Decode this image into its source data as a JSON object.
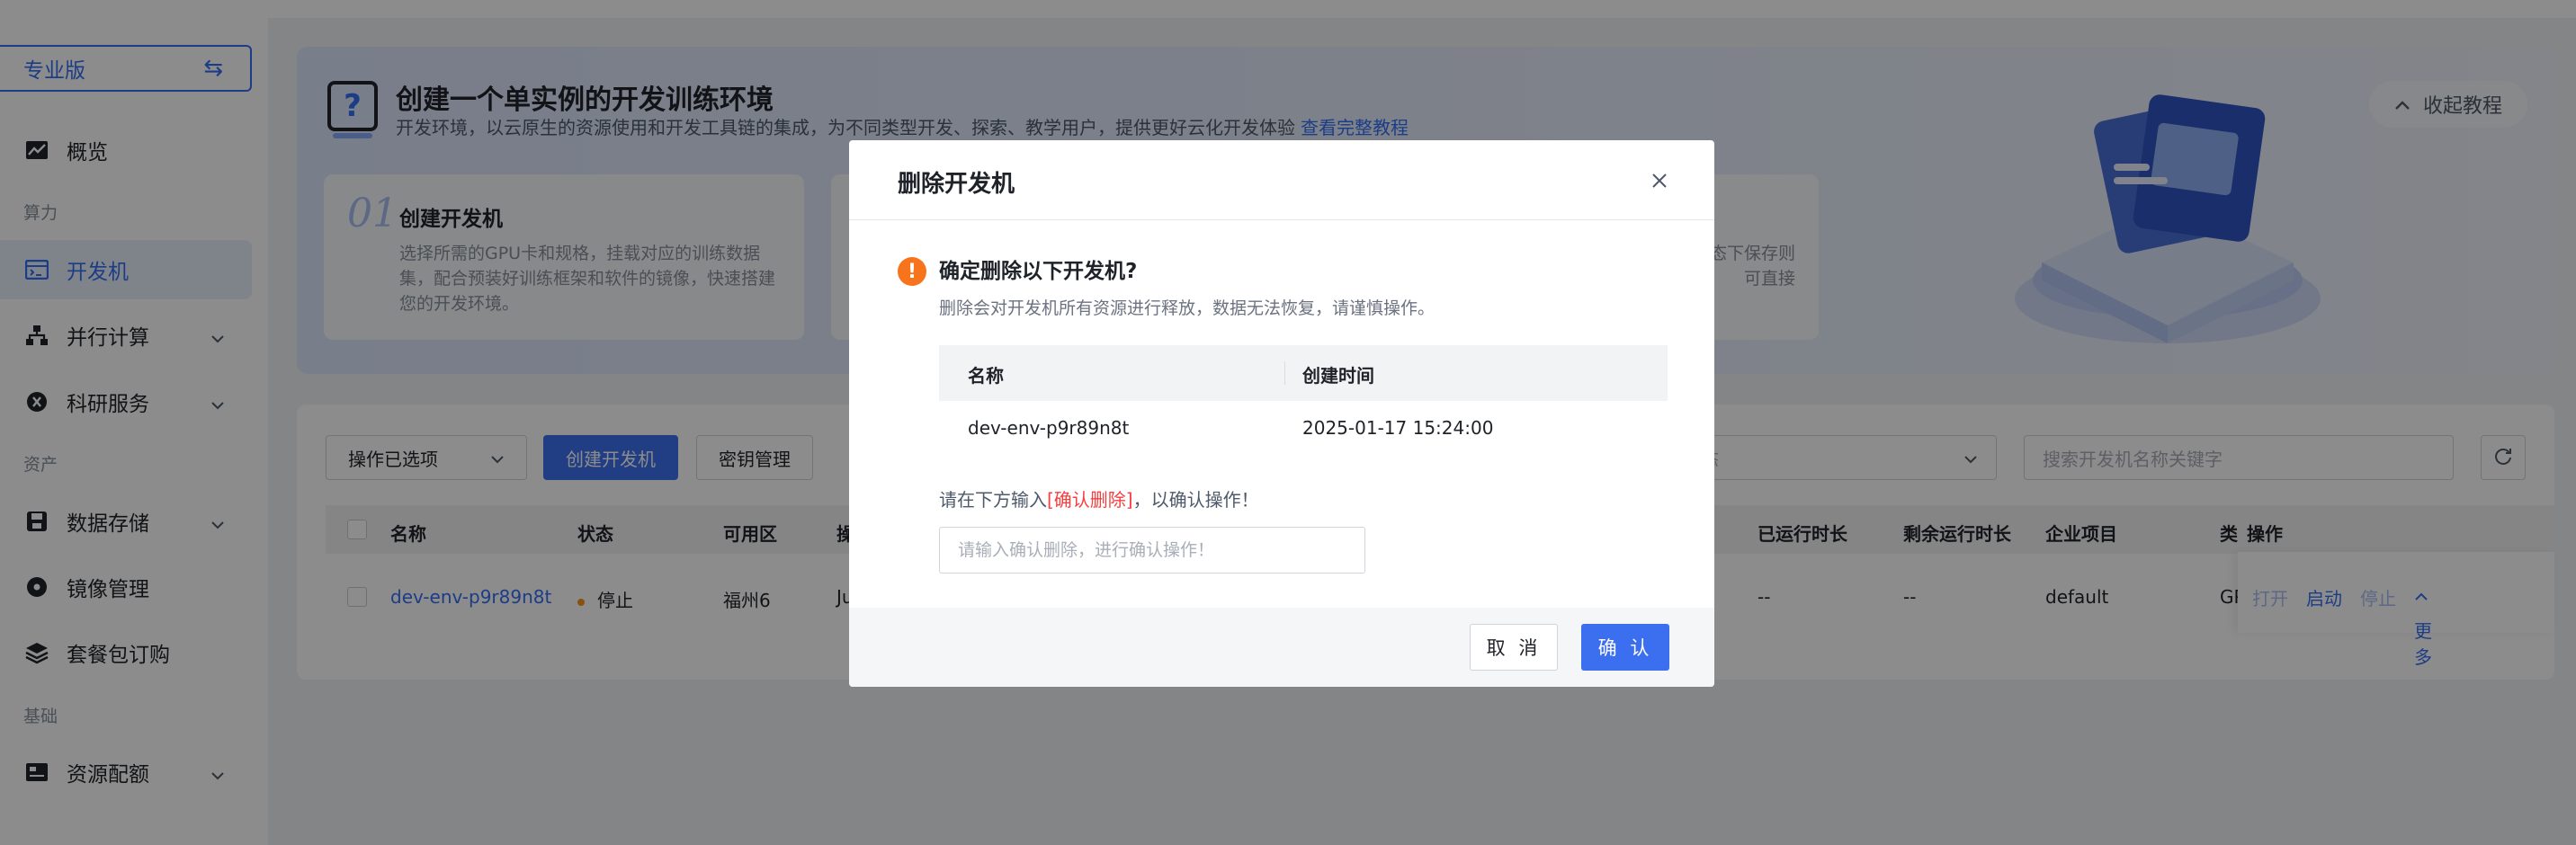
{
  "sidebar": {
    "edition_label": "专业版",
    "items": [
      {
        "label": "概览",
        "icon": "chart-line-icon"
      },
      {
        "label": "开发机",
        "icon": "code-terminal-icon",
        "active": true
      },
      {
        "label": "并行计算",
        "icon": "sitemap-icon"
      },
      {
        "label": "科研服务",
        "icon": "flask-icon"
      },
      {
        "label": "数据存储",
        "icon": "save-disk-icon"
      },
      {
        "label": "镜像管理",
        "icon": "disc-icon"
      },
      {
        "label": "套餐包订购",
        "icon": "layers-icon"
      },
      {
        "label": "资源配额",
        "icon": "quota-icon"
      }
    ],
    "groups": {
      "compute": "算力",
      "assets": "资产",
      "basic": "基础"
    }
  },
  "banner": {
    "title": "创建一个单实例的开发训练环境",
    "desc": "开发环境，以云原生的资源使用和开发工具链的集成，为不同类型开发、探索、教学用户，提供更好云化开发体验",
    "link": "查看完整教程",
    "collapse": "收起教程",
    "step1": {
      "num": "01",
      "title": "创建开发机",
      "desc": "选择所需的GPU卡和规格，挂载对应的训练数据集，配合预装好训练框架和软件的镜像，快速搭建您的开发环境。"
    },
    "step_fragment": "状态下保存则可直接"
  },
  "toolbar": {
    "ops_select": "操作已选项",
    "create": "创建开发机",
    "key_mgmt": "密钥管理",
    "filter_fragment": "态",
    "search_placeholder": "搜索开发机名称关键字"
  },
  "table": {
    "headers": {
      "name": "名称",
      "status": "状态",
      "zone": "可用区",
      "col4": "操",
      "runtime": "已运行时长",
      "remaining": "剩余运行时长",
      "project": "企业项目",
      "type": "类",
      "ops": "操作"
    },
    "row": {
      "name": "dev-env-p9r89n8t",
      "status": "停止",
      "zone": "福州6",
      "col4": "Ju",
      "runtime": "--",
      "remaining": "--",
      "project": "default",
      "type": "GP",
      "ops": {
        "open": "打开",
        "start": "启动",
        "stop": "停止",
        "more": "更多"
      }
    }
  },
  "modal": {
    "title": "删除开发机",
    "question": "确定删除以下开发机?",
    "subtitle": "删除会对开发机所有资源进行释放，数据无法恢复，请谨慎操作。",
    "col_name": "名称",
    "col_time": "创建时间",
    "row_name": "dev-env-p9r89n8t",
    "row_time": "2025-01-17 15:24:00",
    "prompt_pre": "请在下方输入",
    "prompt_keyword": "[确认删除]",
    "prompt_post": "，以确认操作！",
    "input_placeholder": "请输入确认删除，进行确认操作！",
    "cancel": "取 消",
    "confirm": "确 认"
  },
  "colors": {
    "accent": "#3c6ff0",
    "warning": "#f7741d",
    "danger": "#f53f3f",
    "status_stopped_dot": "#f7941d"
  }
}
